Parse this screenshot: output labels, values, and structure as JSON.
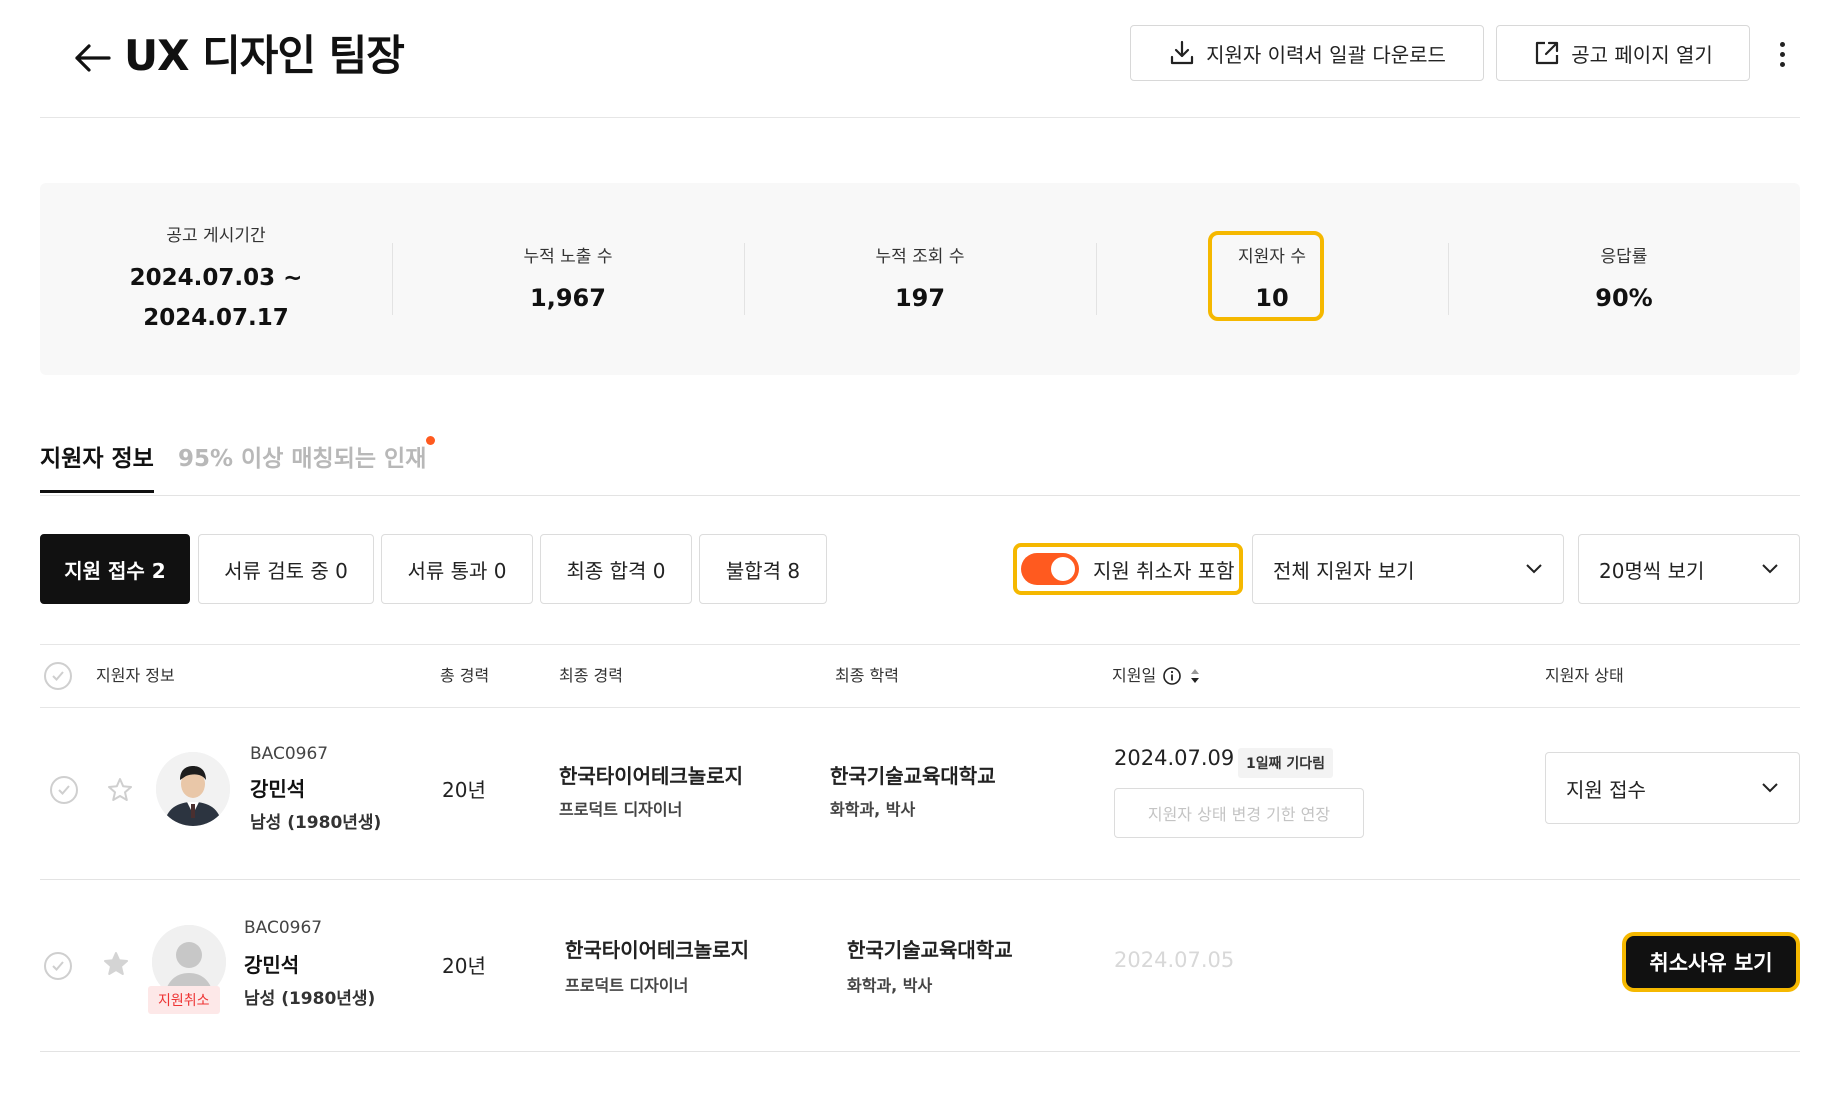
{
  "header": {
    "title": "UX 디자인 팀장",
    "download_label": "지원자 이력서 일괄 다운로드",
    "open_label": "공고 페이지 열기"
  },
  "stats": [
    {
      "label": "공고 게시기간",
      "value_line1": "2024.07.03 ~",
      "value_line2": "2024.07.17"
    },
    {
      "label": "누적 노출 수",
      "value": "1,967"
    },
    {
      "label": "누적 조회 수",
      "value": "197"
    },
    {
      "label": "지원자 수",
      "value": "10"
    },
    {
      "label": "응답률",
      "value": "90%"
    }
  ],
  "tabs": [
    {
      "label": "지원자 정보",
      "active": true
    },
    {
      "label": "95% 이상 매칭되는 인재",
      "active": false
    }
  ],
  "filters": [
    {
      "label": "지원 접수 2",
      "active": true
    },
    {
      "label": "서류 검토 중 0",
      "active": false
    },
    {
      "label": "서류 통과 0",
      "active": false
    },
    {
      "label": "최종 합격 0",
      "active": false
    },
    {
      "label": "불합격 8",
      "active": false
    }
  ],
  "toggle": {
    "label": "지원 취소자 포함",
    "on": true
  },
  "selects": {
    "applicants": "전체 지원자 보기",
    "per_page": "20명씩 보기"
  },
  "table": {
    "headers": {
      "info": "지원자 정보",
      "total_career": "총 경력",
      "last_career": "최종 경력",
      "education": "최종 학력",
      "applied": "지원일",
      "status": "지원자 상태"
    },
    "rows": [
      {
        "code": "BAC0967",
        "name": "강민석",
        "gender": "남성 (1980년생)",
        "career": "20년",
        "company": "한국타이어테크놀로지",
        "role": "프로덕트 디자이너",
        "school": "한국기술교육대학교",
        "major": "화학과, 박사",
        "date": "2024.07.09",
        "wait": "1일째 기다림",
        "extend_label": "지원자 상태 변경 기한 연장",
        "status": "지원 접수"
      },
      {
        "code": "BAC0967",
        "name": "강민석",
        "gender": "남성 (1980년생)",
        "career": "20년",
        "company": "한국타이어테크놀로지",
        "role": "프로덕트 디자이너",
        "school": "한국기술교육대학교",
        "major": "화학과, 박사",
        "date": "2024.07.05",
        "cancel_badge": "지원취소",
        "reason_label": "취소사유 보기"
      }
    ]
  },
  "colors": {
    "accent": "#ff5a1f",
    "highlight": "#f5b800",
    "dark": "#111111"
  }
}
